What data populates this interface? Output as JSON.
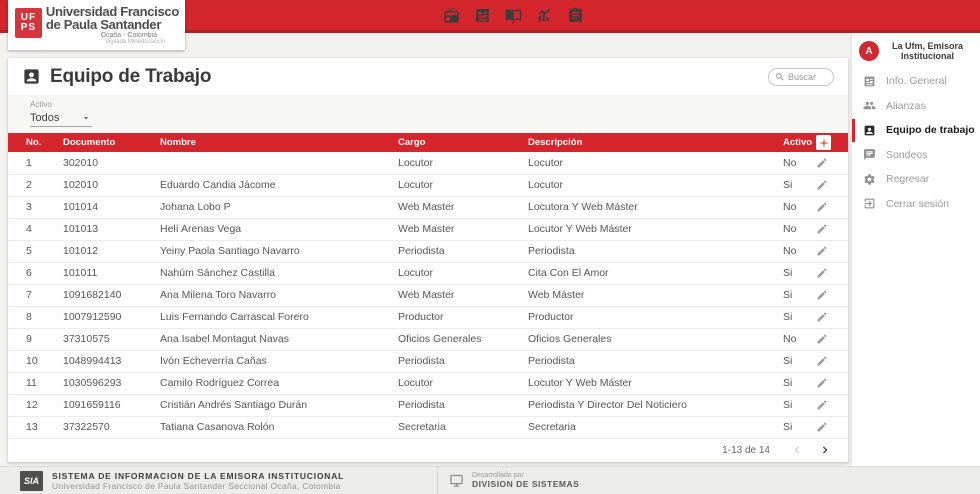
{
  "colors": {
    "primary_red": "#d4262c",
    "logo_red": "#d5353c",
    "page_bg": "#f3f2ef",
    "card_bg": "#ffffff",
    "footer_bg": "#ececea",
    "inactive_text": "#9c9c9c",
    "active_text": "#1c1c1c"
  },
  "brand": {
    "logo_monogram_top": "UF",
    "logo_monogram_bottom": "PS",
    "name_line1": "Universidad Francisco",
    "name_line2": "de Paula Santander",
    "location": "Ocaña - Colombia",
    "tagline": "Vigilada Mineducación"
  },
  "topbar": {
    "icons": [
      "radio-icon",
      "newspaper-icon",
      "lectern-icon",
      "stats-icon",
      "notes-icon"
    ]
  },
  "sidebar": {
    "profile": {
      "avatar_initial": "A",
      "name": "La Ufm, Emisora Institucional"
    },
    "items": [
      {
        "label": "Info. General",
        "icon": "news-icon",
        "active": false
      },
      {
        "label": "Alianzas",
        "icon": "people-icon",
        "active": false
      },
      {
        "label": "Equipo de trabajo",
        "icon": "badge-icon",
        "active": true
      },
      {
        "label": "Sondeos",
        "icon": "comment-icon",
        "active": false
      },
      {
        "label": "Regresar",
        "icon": "gear-icon",
        "active": false
      },
      {
        "label": "Cerrar sesión",
        "icon": "logout-icon",
        "active": false
      }
    ]
  },
  "main": {
    "title": "Equipo de Trabajo",
    "search_placeholder": "Buscar",
    "filter": {
      "label": "Activo",
      "value": "Todos"
    },
    "table": {
      "columns": [
        "No.",
        "Documento",
        "Nombre",
        "Cargo",
        "Descripción",
        "Activo"
      ],
      "rows": [
        {
          "no": "1",
          "documento": "302010",
          "nombre": "",
          "cargo": "Locutor",
          "descripcion": "Locutor",
          "activo": "No"
        },
        {
          "no": "2",
          "documento": "102010",
          "nombre": "Eduardo Candia Jácome",
          "cargo": "Locutor",
          "descripcion": "Locutor",
          "activo": "Si"
        },
        {
          "no": "3",
          "documento": "101014",
          "nombre": "Johana Lobo P",
          "cargo": "Web Master",
          "descripcion": "Locutora Y Web Máster",
          "activo": "No"
        },
        {
          "no": "4",
          "documento": "101013",
          "nombre": "Helí Arenas Vega",
          "cargo": "Web Master",
          "descripcion": "Locutor Y Web Máster",
          "activo": "No"
        },
        {
          "no": "5",
          "documento": "101012",
          "nombre": "Yeiny Paola Santiago Navarro",
          "cargo": "Periodista",
          "descripcion": "Periodista",
          "activo": "No"
        },
        {
          "no": "6",
          "documento": "101011",
          "nombre": "Nahúm Sánchez Castilla",
          "cargo": "Locutor",
          "descripcion": "Cita Con El Amor",
          "activo": "Si"
        },
        {
          "no": "7",
          "documento": "1091682140",
          "nombre": "Ana Milena Toro Navarro",
          "cargo": "Web Master",
          "descripcion": "Web Máster",
          "activo": "Si"
        },
        {
          "no": "8",
          "documento": "1007912590",
          "nombre": "Luis Fernando Carrascal Forero",
          "cargo": "Productor",
          "descripcion": "Productor",
          "activo": "Si"
        },
        {
          "no": "9",
          "documento": "37310575",
          "nombre": "Ana Isabel Montagut Navas",
          "cargo": "Oficios Generales",
          "descripcion": "Oficios Generales",
          "activo": "No"
        },
        {
          "no": "10",
          "documento": "1048994413",
          "nombre": "Ivón Echeverría Cañas",
          "cargo": "Periodista",
          "descripcion": "Periodista",
          "activo": "Si"
        },
        {
          "no": "11",
          "documento": "1030596293",
          "nombre": "Camilo Rodríguez Correa",
          "cargo": "Locutor",
          "descripcion": "Locutor Y Web Máster",
          "activo": "Si"
        },
        {
          "no": "12",
          "documento": "1091659116",
          "nombre": "Cristián Andrés Santiago Durán",
          "cargo": "Periodista",
          "descripcion": "Periodista Y Director Del Noticiero",
          "activo": "Si"
        },
        {
          "no": "13",
          "documento": "37322570",
          "nombre": "Tatiana Casanova Rolón",
          "cargo": "Secretaria",
          "descripcion": "Secretaria",
          "activo": "Si"
        }
      ],
      "pagination": {
        "range_text": "1-13 de 14"
      }
    }
  },
  "footer": {
    "logo_text": "SIA",
    "title": "SISTEMA DE INFORMACION DE LA EMISORA INSTITUCIONAL",
    "subtitle": "Universidad Francisco de Paula Santander Seccional Ocaña, Colombia",
    "dev_label": "Desarrollado por",
    "dev_name": "DIVISION DE SISTEMAS"
  }
}
